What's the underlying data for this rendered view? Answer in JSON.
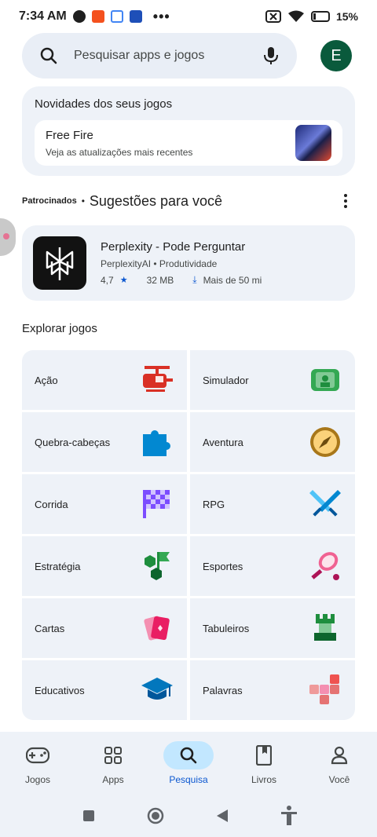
{
  "status_bar": {
    "time": "7:34 AM",
    "battery": "15%",
    "more_notifications": "•••"
  },
  "search": {
    "placeholder": "Pesquisar apps e jogos"
  },
  "profile": {
    "avatar_letter": "E",
    "avatar_color": "#0a5a3c"
  },
  "updates_card": {
    "title": "Novidades dos seus jogos",
    "game_name": "Free Fire",
    "game_subtitle": "Veja as atualizações mais recentes"
  },
  "suggestions": {
    "sponsored_label": "Patrocinados",
    "separator": "•",
    "title": "Sugestões para você",
    "app": {
      "name": "Perplexity - Pode Perguntar",
      "developer": "PerplexityAI",
      "category": "Produtividade",
      "rating": "4,7",
      "size": "32 MB",
      "downloads": "Mais de 50 mi"
    }
  },
  "explore": {
    "title": "Explorar jogos",
    "categories": [
      {
        "label": "Ação",
        "icon": "helicopter-icon"
      },
      {
        "label": "Simulador",
        "icon": "simulator-icon"
      },
      {
        "label": "Quebra-cabeças",
        "icon": "puzzle-piece-icon"
      },
      {
        "label": "Aventura",
        "icon": "compass-icon"
      },
      {
        "label": "Corrida",
        "icon": "checkered-flag-icon"
      },
      {
        "label": "RPG",
        "icon": "crossed-swords-icon"
      },
      {
        "label": "Estratégia",
        "icon": "strategy-flag-icon"
      },
      {
        "label": "Esportes",
        "icon": "tennis-racket-icon"
      },
      {
        "label": "Cartas",
        "icon": "cards-icon"
      },
      {
        "label": "Tabuleiros",
        "icon": "chess-piece-icon"
      },
      {
        "label": "Educativos",
        "icon": "graduation-cap-icon"
      },
      {
        "label": "Palavras",
        "icon": "letter-tiles-icon"
      }
    ]
  },
  "bottom_nav": {
    "items": [
      {
        "label": "Jogos",
        "icon": "gamepad-icon"
      },
      {
        "label": "Apps",
        "icon": "apps-grid-icon"
      },
      {
        "label": "Pesquisa",
        "icon": "search-icon",
        "active": true
      },
      {
        "label": "Livros",
        "icon": "book-icon"
      },
      {
        "label": "Você",
        "icon": "person-icon"
      }
    ]
  },
  "colors": {
    "accent": "#0b57d0",
    "active_pill": "#c2e7ff",
    "surface": "#eef2f8"
  }
}
